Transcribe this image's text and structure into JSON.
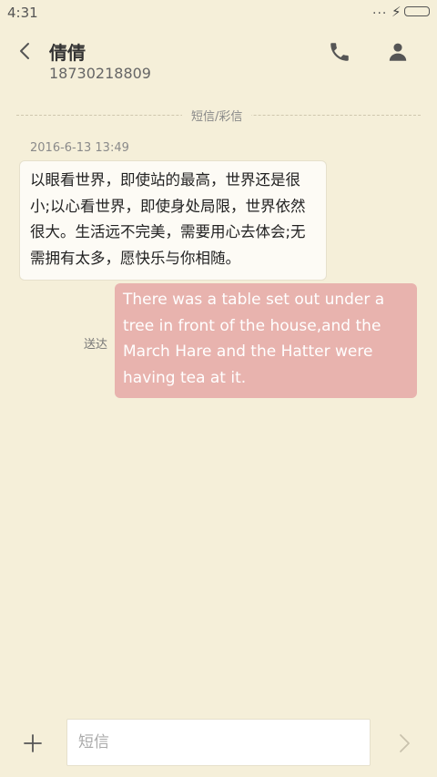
{
  "status_bar": {
    "time": "4:31",
    "dots": "...",
    "bolt": "⚡"
  },
  "header": {
    "contact_name": "倩倩",
    "contact_number": "18730218809"
  },
  "conversation": {
    "divider_label": "短信/彩信",
    "timestamp": "2016-6-13 13:49",
    "incoming_message": "以眼看世界，即使站的最高，世界还是很小;以心看世界，即使身处局限，世界依然很大。生活远不完美，需要用心去体会;无需拥有太多，愿快乐与你相随。",
    "outgoing_status": "送达",
    "outgoing_message": "There was a table set out under a tree in front of the house,and the March Hare and the Hatter were having tea at it."
  },
  "composer": {
    "placeholder": "短信"
  },
  "colors": {
    "background": "#f5efd9",
    "incoming_bubble": "#fdfbf5",
    "outgoing_bubble": "#e8b3ae",
    "icon": "#555555"
  },
  "icons": {
    "back": "back-icon",
    "call": "phone-icon",
    "profile": "person-icon",
    "attach": "plus-icon",
    "send": "send-icon"
  }
}
